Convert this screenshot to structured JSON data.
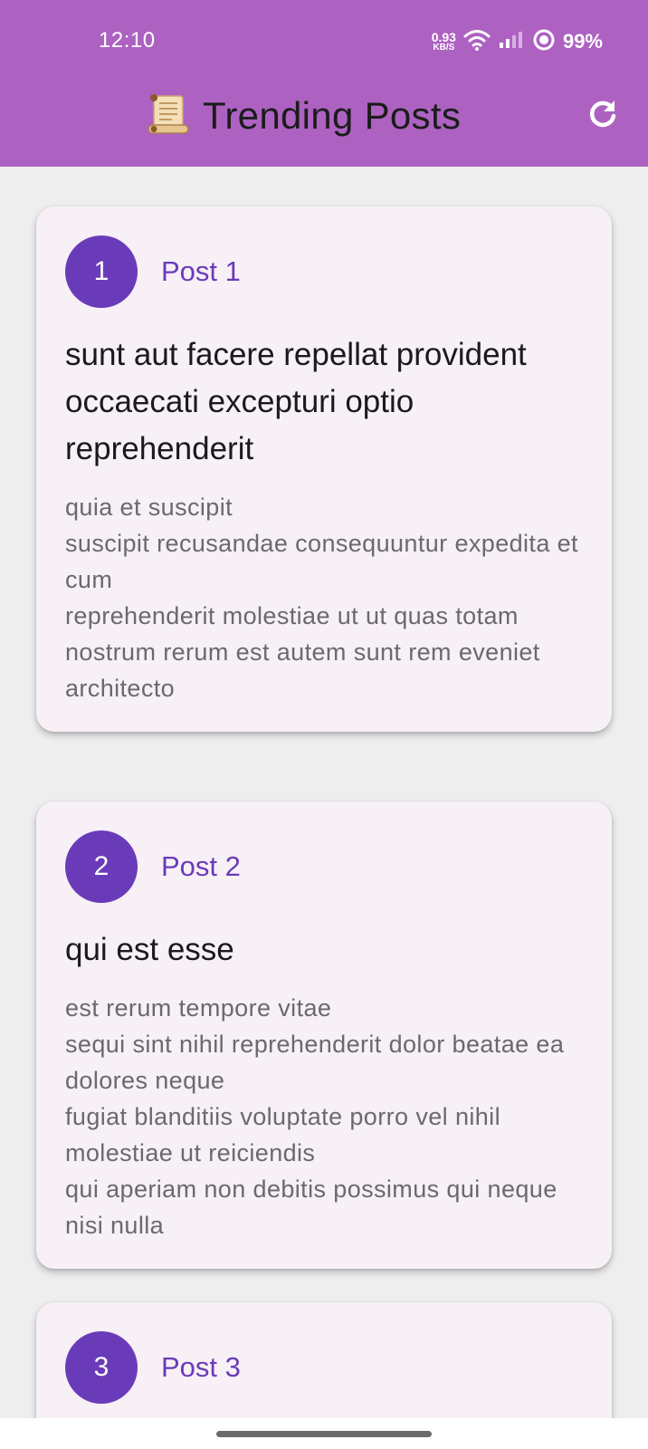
{
  "status_bar": {
    "time": "12:10",
    "net_speed_value": "0.93",
    "net_speed_unit": "KB/S",
    "battery": "99%"
  },
  "app_bar": {
    "title": "Trending Posts",
    "title_icon": "scroll-icon",
    "action_icon": "refresh-icon",
    "background_color": "#ad62c2"
  },
  "posts": [
    {
      "number": "1",
      "label": "Post 1",
      "title": "sunt aut facere repellat provident occaecati excepturi optio reprehenderit",
      "body": "quia et suscipit\nsuscipit recusandae consequuntur expedita et cum\nreprehenderit molestiae ut ut quas totam\nnostrum rerum est autem sunt rem eveniet architecto"
    },
    {
      "number": "2",
      "label": "Post 2",
      "title": "qui est esse",
      "body": "est rerum tempore vitae\nsequi sint nihil reprehenderit dolor beatae ea dolores neque\nfugiat blanditiis voluptate porro vel nihil molestiae ut reiciendis\nqui aperiam non debitis possimus qui neque nisi nulla"
    },
    {
      "number": "3",
      "label": "Post 3"
    }
  ],
  "colors": {
    "accent": "#6a3bb8",
    "card_background": "#f7f0f7",
    "page_background": "#eeeeee"
  }
}
